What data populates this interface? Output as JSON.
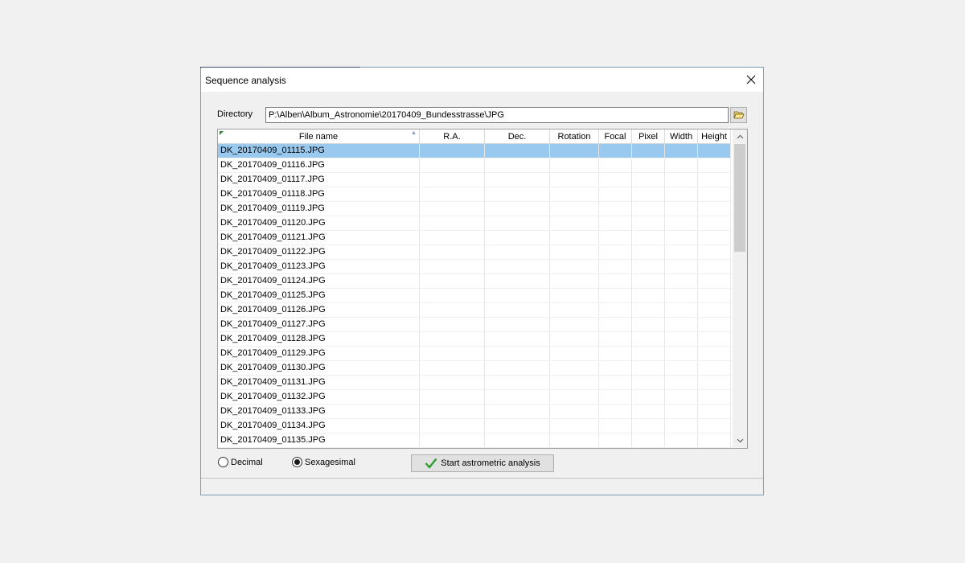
{
  "dialog": {
    "title": "Sequence analysis",
    "close_icon": "close-icon"
  },
  "directory": {
    "label": "Directory",
    "value": "P:\\Alben\\Album_Astronomie\\20170409_Bundesstrasse\\JPG",
    "browse_icon": "folder-open-icon"
  },
  "table": {
    "columns": [
      "File name",
      "R.A.",
      "Dec.",
      "Rotation",
      "Focal",
      "Pixel",
      "Width",
      "Height"
    ],
    "selected_row": 0,
    "rows": [
      "DK_20170409_01115.JPG",
      "DK_20170409_01116.JPG",
      "DK_20170409_01117.JPG",
      "DK_20170409_01118.JPG",
      "DK_20170409_01119.JPG",
      "DK_20170409_01120.JPG",
      "DK_20170409_01121.JPG",
      "DK_20170409_01122.JPG",
      "DK_20170409_01123.JPG",
      "DK_20170409_01124.JPG",
      "DK_20170409_01125.JPG",
      "DK_20170409_01126.JPG",
      "DK_20170409_01127.JPG",
      "DK_20170409_01128.JPG",
      "DK_20170409_01129.JPG",
      "DK_20170409_01130.JPG",
      "DK_20170409_01131.JPG",
      "DK_20170409_01132.JPG",
      "DK_20170409_01133.JPG",
      "DK_20170409_01134.JPG",
      "DK_20170409_01135.JPG"
    ]
  },
  "format": {
    "decimal_label": "Decimal",
    "sexagesimal_label": "Sexagesimal",
    "selected": "sexagesimal"
  },
  "actions": {
    "start_label": "Start astrometric analysis",
    "start_icon": "checkmark-icon"
  },
  "colors": {
    "selection": "#99c9ef",
    "checkmark": "#2e9b2e"
  }
}
